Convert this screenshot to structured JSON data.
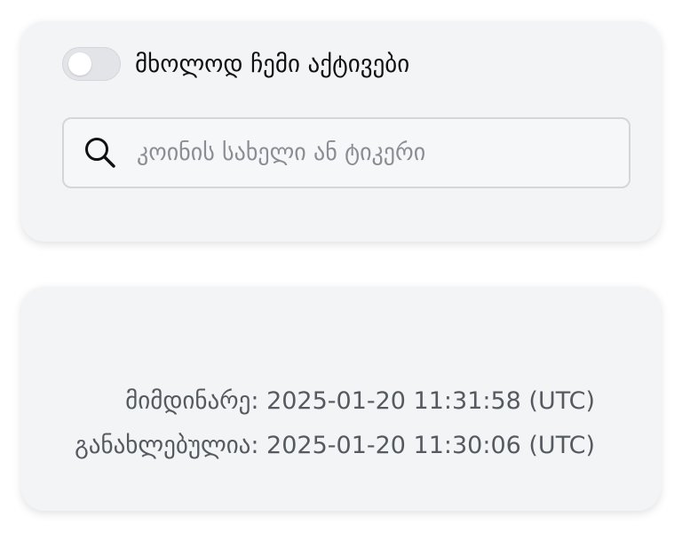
{
  "filter": {
    "toggle_label": "მხოლოდ ჩემი აქტივები",
    "toggle_on": false
  },
  "search": {
    "placeholder": "კოინის სახელი ან ტიკერი",
    "value": "",
    "icon": "search-icon"
  },
  "status": {
    "current": "მიმდინარე: 2025-01-20 11:31:58 (UTC)",
    "updated": "განახლებულია: 2025-01-20 11:30:06 (UTC)"
  }
}
